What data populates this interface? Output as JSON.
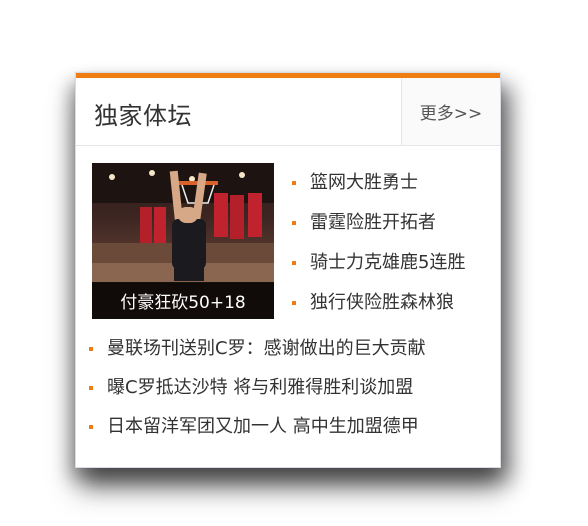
{
  "widget": {
    "title": "独家体坛",
    "more_label": "更多>>",
    "accent_color": "#f07d12"
  },
  "featured": {
    "caption": "付豪狂砍50+18"
  },
  "side_items": [
    {
      "label": "篮网大胜勇士"
    },
    {
      "label": "雷霆险胜开拓者"
    },
    {
      "label": "骑士力克雄鹿5连胜"
    },
    {
      "label": "独行侠险胜森林狼"
    }
  ],
  "bottom_items": [
    {
      "label": "曼联场刊送别C罗：感谢做出的巨大贡献"
    },
    {
      "label": "曝C罗抵达沙特 将与利雅得胜利谈加盟"
    },
    {
      "label": "日本留洋军团又加一人 高中生加盟德甲"
    }
  ]
}
